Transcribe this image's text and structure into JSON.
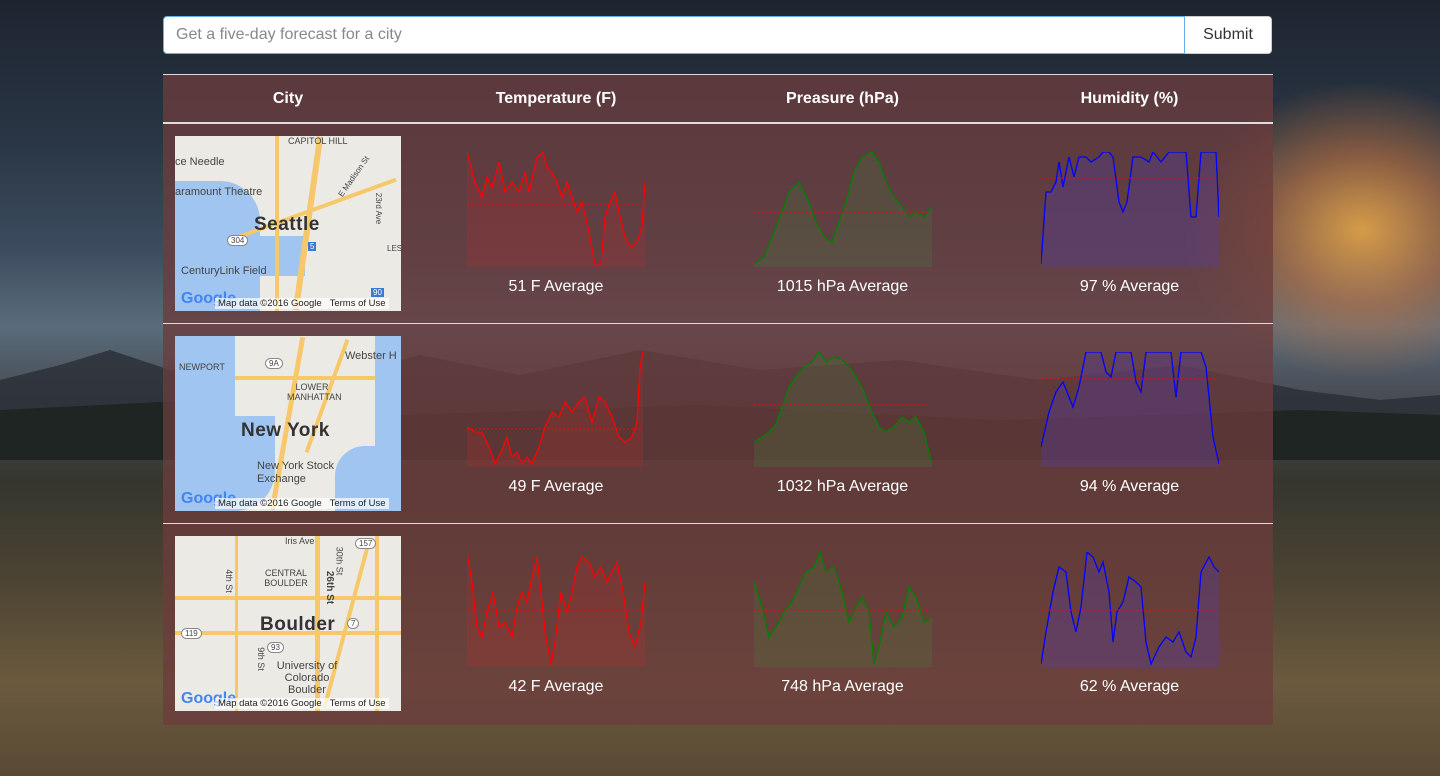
{
  "search": {
    "placeholder": "Get a five-day forecast for a city",
    "submit_label": "Submit"
  },
  "table": {
    "headers": [
      "City",
      "Temperature (F)",
      "Preasure (hPa)",
      "Humidity (%)"
    ]
  },
  "map_attribution": "Map data ©2016 Google",
  "map_terms": "Terms of Use",
  "map_logo": "Google",
  "colors": {
    "temperature": "#ff0000",
    "pressure": "#008000",
    "humidity": "#0000ff",
    "average_line": "#ff0000"
  },
  "rows": [
    {
      "city": "Seattle",
      "map_labels": [
        "ce Needle",
        "CAPITOL HILL",
        "aramount Theatre",
        "E Madison St",
        "23rd Ave",
        "304",
        "5",
        "CenturyLink Field",
        "LES",
        "90"
      ],
      "temp_avg": "51 F Average",
      "pressure_avg": "1015 hPa Average",
      "humidity_avg": "97 % Average"
    },
    {
      "city": "New York",
      "map_labels": [
        "NEWPORT",
        "9A",
        "Webster H",
        "LOWER MANHATTAN",
        "New York Stock Exchange"
      ],
      "temp_avg": "49 F Average",
      "pressure_avg": "1032 hPa Average",
      "humidity_avg": "94 % Average"
    },
    {
      "city": "Boulder",
      "map_labels": [
        "Iris Ave",
        "30th St",
        "157",
        "CENTRAL BOULDER",
        "4th St",
        "26th St",
        "119",
        "7",
        "93",
        "9th St",
        "University of Colorado Boulder"
      ],
      "temp_avg": "42 F Average",
      "pressure_avg": "748 hPa Average",
      "humidity_avg": "62 % Average"
    }
  ]
}
